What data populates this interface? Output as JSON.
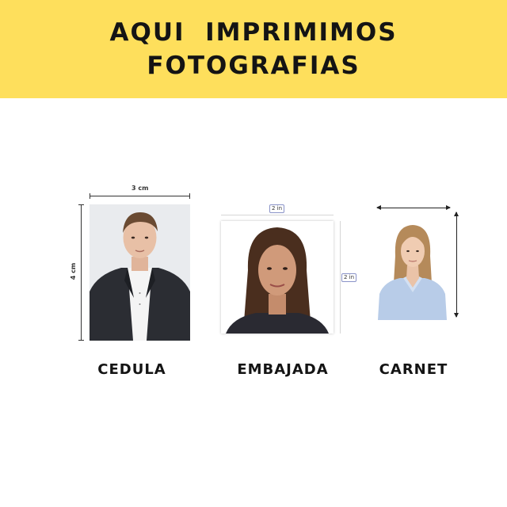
{
  "banner": {
    "line1": "AQUI  IMPRIMIMOS",
    "line2": "FOTOGRAFIAS",
    "background": "#fedf5c"
  },
  "photos": [
    {
      "caption": "CEDULA",
      "width_label": "3 cm",
      "height_label": "4 cm",
      "subject": "man in dark suit and white shirt"
    },
    {
      "caption": "EMBAJADA",
      "width_label": "2 in",
      "height_label": "2 in",
      "subject": "woman with long dark hair"
    },
    {
      "caption": "CARNET",
      "subject": "woman with blonde hair in light blue shirt"
    }
  ]
}
